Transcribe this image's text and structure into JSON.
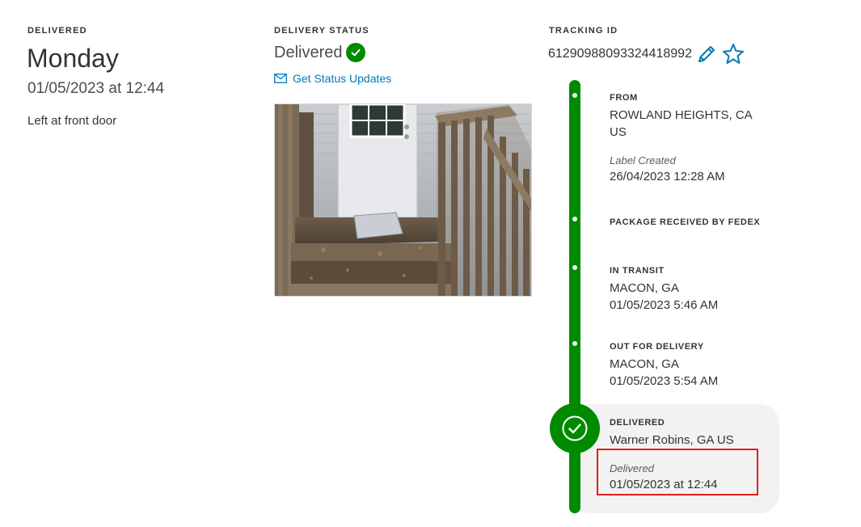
{
  "summary": {
    "eyebrow": "DELIVERED",
    "day": "Monday",
    "datetime": "01/05/2023 at 12:44",
    "note": "Left at front door"
  },
  "status": {
    "eyebrow": "DELIVERY STATUS",
    "value": "Delivered",
    "updates_link": "Get Status Updates"
  },
  "tracking": {
    "eyebrow": "TRACKING ID",
    "id": "61290988093324418992"
  },
  "timeline": {
    "from": {
      "title": "FROM",
      "location_line1": "ROWLAND HEIGHTS, CA",
      "location_line2": "US",
      "sub_label": "Label Created",
      "timestamp": "26/04/2023 12:28 AM"
    },
    "received": {
      "title": "PACKAGE RECEIVED BY FEDEX"
    },
    "in_transit": {
      "title": "IN TRANSIT",
      "location": "MACON, GA",
      "timestamp": "01/05/2023 5:46 AM"
    },
    "out_for_delivery": {
      "title": "OUT FOR DELIVERY",
      "location": "MACON, GA",
      "timestamp": "01/05/2023 5:54 AM"
    },
    "delivered": {
      "title": "DELIVERED",
      "location": "Warner Robins, GA US",
      "sub_label": "Delivered",
      "timestamp": "01/05/2023 at 12:44"
    }
  },
  "colors": {
    "brand_green": "#008a00",
    "link_blue": "#007ab7",
    "highlight_red": "#e0201c",
    "card_gray": "#f2f2f2"
  },
  "icons": [
    "check-circle-icon",
    "envelope-icon",
    "pencil-icon",
    "star-icon"
  ]
}
